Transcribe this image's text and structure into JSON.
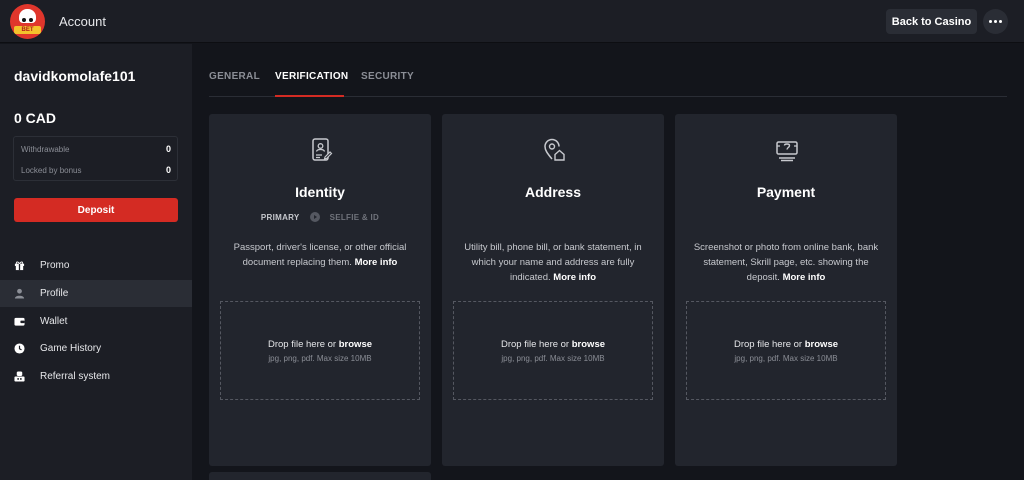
{
  "topbar": {
    "logo_text": "BET",
    "title": "Account",
    "back_label": "Back to Casino",
    "more_icon": "more-dots-icon"
  },
  "sidebar": {
    "username": "davidkomolafe101",
    "balance": "0 CAD",
    "withdrawable_label": "Withdrawable",
    "withdrawable_value": "0",
    "locked_label": "Locked by bonus",
    "locked_value": "0",
    "deposit_label": "Deposit",
    "items": [
      {
        "label": "Promo",
        "icon": "gift-icon"
      },
      {
        "label": "Profile",
        "icon": "user-icon",
        "active": true
      },
      {
        "label": "Wallet",
        "icon": "wallet-icon"
      },
      {
        "label": "Game History",
        "icon": "clock-icon"
      },
      {
        "label": "Referral system",
        "icon": "referral-icon"
      }
    ]
  },
  "tabs": [
    {
      "label": "GENERAL"
    },
    {
      "label": "VERIFICATION",
      "active": true
    },
    {
      "label": "SECURITY"
    }
  ],
  "cards": [
    {
      "title": "Identity",
      "icon": "id-document-icon",
      "step_primary": "PRIMARY",
      "step_secondary": "SELFIE & ID",
      "desc": "Passport, driver's license, or other official document replacing them.",
      "more": "More info",
      "drop_text": "Drop file here or",
      "drop_link": "browse",
      "drop_hint": "jpg, png, pdf. Max size 10MB"
    },
    {
      "title": "Address",
      "icon": "location-home-icon",
      "desc": "Utility bill, phone bill, or bank statement, in which your name and address are fully indicated.",
      "more": "More info",
      "drop_text": "Drop file here or",
      "drop_link": "browse",
      "drop_hint": "jpg, png, pdf. Max size 10MB"
    },
    {
      "title": "Payment",
      "icon": "payment-card-icon",
      "desc": "Screenshot or photo from online bank, bank statement, Skrill page, etc. showing the deposit.",
      "more": "More info",
      "drop_text": "Drop file here or",
      "drop_link": "browse",
      "drop_hint": "jpg, png, pdf. Max size 10MB"
    }
  ],
  "colors": {
    "background": "#13151b",
    "panel": "#1c1e25",
    "card": "#22252d",
    "accent": "#d42b23"
  }
}
